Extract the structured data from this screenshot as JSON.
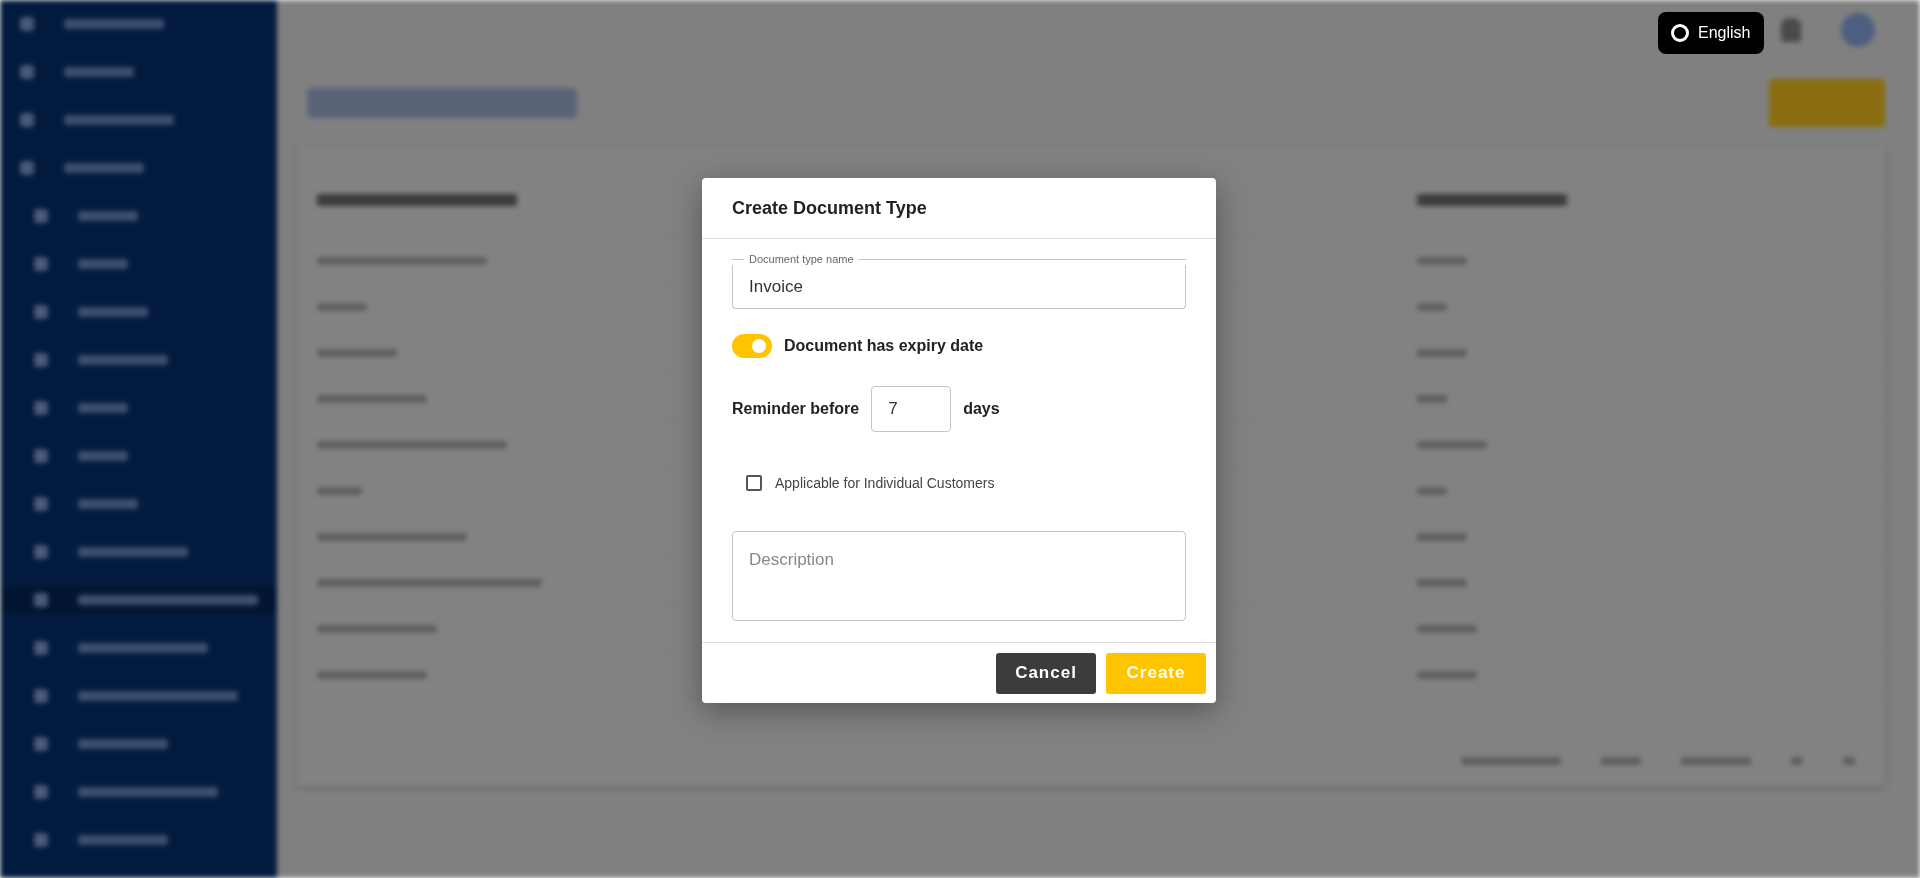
{
  "language_button": {
    "label": "English"
  },
  "dialog": {
    "title": "Create Document Type",
    "name_field": {
      "label": "Document type name",
      "value": "Invoice"
    },
    "expiry_toggle": {
      "label": "Document has expiry date",
      "on": true
    },
    "reminder": {
      "label": "Reminder before",
      "value": "7",
      "unit": "days"
    },
    "individual_checkbox": {
      "label": "Applicable for Individual Customers",
      "checked": false
    },
    "description_field": {
      "placeholder": "Description"
    },
    "buttons": [
      {
        "label": "Cancel",
        "kind": "secondary"
      },
      {
        "label": "Create",
        "kind": "primary"
      }
    ]
  }
}
